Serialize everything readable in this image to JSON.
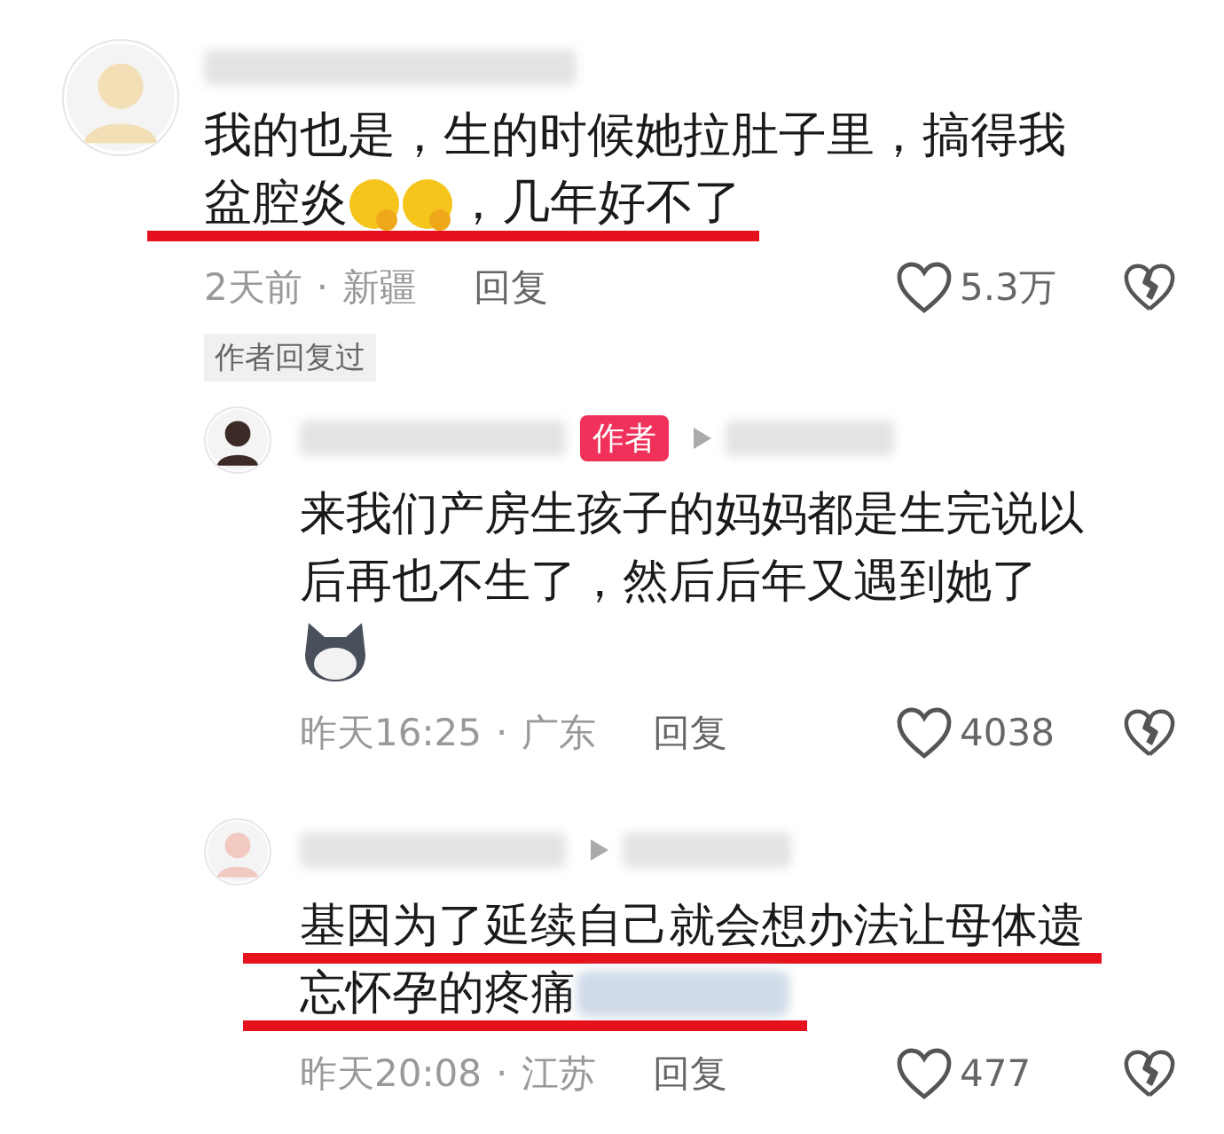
{
  "comments": [
    {
      "lines": [
        {
          "underlined": false,
          "segments": [
            {
              "kind": "text",
              "text": "我的也是，生的时候她拉肚子里，搞得我"
            }
          ]
        },
        {
          "underlined": true,
          "segments": [
            {
              "kind": "text",
              "text": "盆腔炎"
            },
            {
              "kind": "emoji"
            },
            {
              "kind": "emoji"
            },
            {
              "kind": "text",
              "text": "，几年好不了"
            }
          ]
        }
      ],
      "time": "2天前",
      "separator": "·",
      "location": "新疆",
      "reply_label": "回复",
      "likes": "5.3万",
      "badge": "作者回复过",
      "replies": [
        {
          "author_tag": "作者",
          "lines": [
            {
              "underlined": false,
              "segments": [
                {
                  "kind": "text",
                  "text": "来我们产房生孩子的妈妈都是生完说以"
                }
              ]
            },
            {
              "underlined": false,
              "segments": [
                {
                  "kind": "text",
                  "text": "后再也不生了，然后后年又遇到她了"
                }
              ]
            },
            {
              "underlined": false,
              "segments": [
                {
                  "kind": "sticker"
                }
              ]
            }
          ],
          "time": "昨天16:25",
          "separator": "·",
          "location": "广东",
          "reply_label": "回复",
          "likes": "4038"
        },
        {
          "lines": [
            {
              "underlined": true,
              "segments": [
                {
                  "kind": "text",
                  "text": "基因为了延续自己就会想办法让母体遗"
                }
              ]
            },
            {
              "underlined": true,
              "segments": [
                {
                  "kind": "text",
                  "text": "忘怀孕的疼痛"
                },
                {
                  "kind": "blur"
                }
              ]
            }
          ],
          "time": "昨天20:08",
          "separator": "·",
          "location": "江苏",
          "reply_label": "回复",
          "likes": "477"
        }
      ]
    }
  ]
}
